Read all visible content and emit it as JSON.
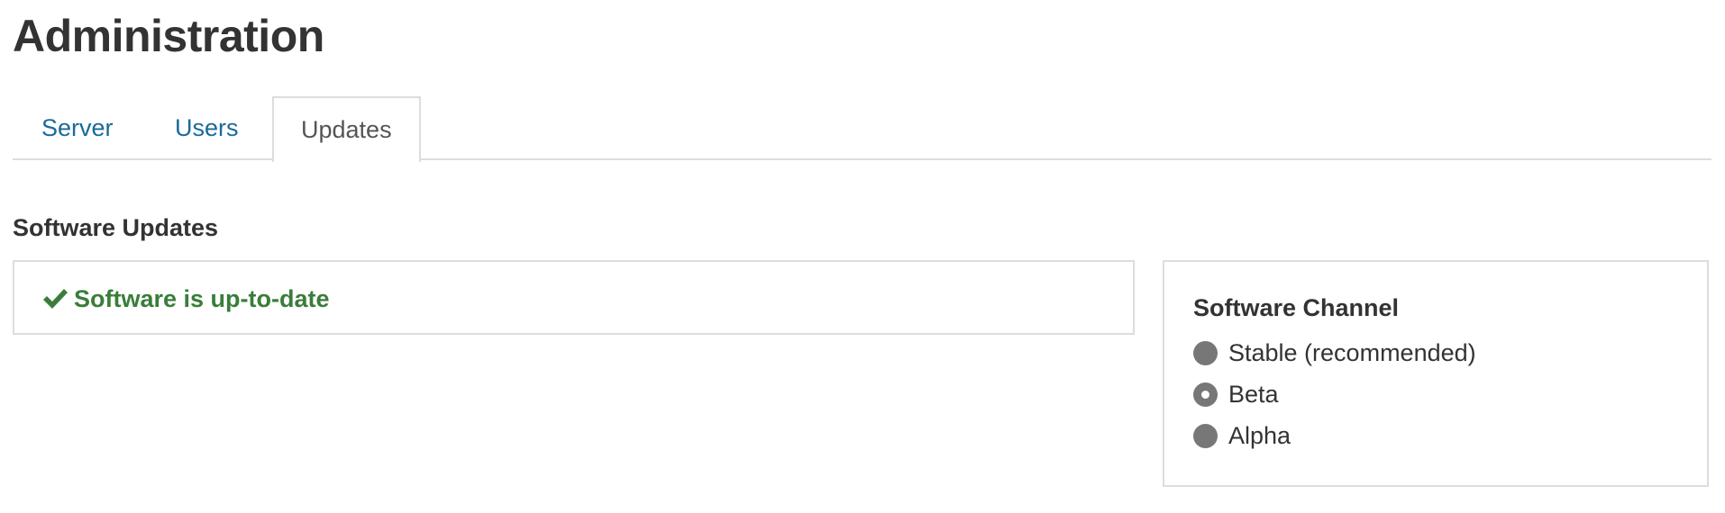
{
  "page": {
    "title": "Administration"
  },
  "tabs": [
    {
      "label": "Server",
      "active": false
    },
    {
      "label": "Users",
      "active": false
    },
    {
      "label": "Updates",
      "active": true
    }
  ],
  "software_updates": {
    "section_title": "Software Updates",
    "status_text": "Software is up-to-date",
    "status_icon": "check-icon",
    "status_color": "#3a7d3a"
  },
  "software_channel": {
    "title": "Software Channel",
    "options": [
      {
        "label": "Stable (recommended)",
        "selected": false
      },
      {
        "label": "Beta",
        "selected": true
      },
      {
        "label": "Alpha",
        "selected": false
      }
    ]
  },
  "colors": {
    "link": "#1a6a9a",
    "border": "#dddddd",
    "radio": "#777777"
  }
}
